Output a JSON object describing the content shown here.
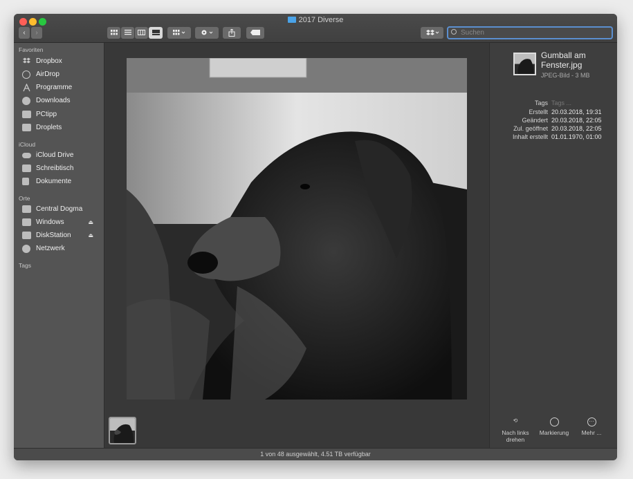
{
  "window": {
    "title": "2017 Diverse"
  },
  "toolbar": {
    "back": "‹",
    "forward": "›",
    "view_icons": [
      "icon-view-icon",
      "list-view-icon",
      "column-view-icon",
      "gallery-view-icon"
    ],
    "search_placeholder": "Suchen"
  },
  "sidebar": {
    "sections": [
      {
        "title": "Favoriten",
        "items": [
          {
            "label": "Dropbox",
            "icon": "dropbox-icon"
          },
          {
            "label": "AirDrop",
            "icon": "airdrop-icon"
          },
          {
            "label": "Programme",
            "icon": "applications-icon"
          },
          {
            "label": "Downloads",
            "icon": "downloads-icon"
          },
          {
            "label": "PCtipp",
            "icon": "folder-icon"
          },
          {
            "label": "Droplets",
            "icon": "folder-icon"
          }
        ]
      },
      {
        "title": "iCloud",
        "items": [
          {
            "label": "iCloud Drive",
            "icon": "cloud-icon"
          },
          {
            "label": "Schreibtisch",
            "icon": "desktop-icon"
          },
          {
            "label": "Dokumente",
            "icon": "documents-icon"
          }
        ]
      },
      {
        "title": "Orte",
        "items": [
          {
            "label": "Central Dogma",
            "icon": "disk-icon"
          },
          {
            "label": "Windows",
            "icon": "disk-icon",
            "eject": "⏏"
          },
          {
            "label": "DiskStation",
            "icon": "disk-icon",
            "eject": "⏏"
          },
          {
            "label": "Netzwerk",
            "icon": "network-icon"
          }
        ]
      },
      {
        "title": "Tags",
        "items": []
      }
    ]
  },
  "info": {
    "name": "Gumball am Fenster.jpg",
    "type": "JPEG-Bild - 3 MB",
    "meta": [
      {
        "key": "Tags",
        "value": "Tags ..."
      },
      {
        "key": "Erstellt",
        "value": "20.03.2018, 19:31"
      },
      {
        "key": "Geändert",
        "value": "20.03.2018, 22:05"
      },
      {
        "key": "Zul. geöffnet",
        "value": "20.03.2018, 22:05"
      },
      {
        "key": "Inhalt erstellt",
        "value": "01.01.1970, 01:00"
      }
    ],
    "actions": [
      {
        "label": "Nach links drehen",
        "icon": "rotate-left-icon"
      },
      {
        "label": "Markierung",
        "icon": "markup-icon"
      },
      {
        "label": "Mehr ...",
        "icon": "more-icon"
      }
    ]
  },
  "status": "1 von 48 ausgewählt, 4.51 TB verfügbar"
}
